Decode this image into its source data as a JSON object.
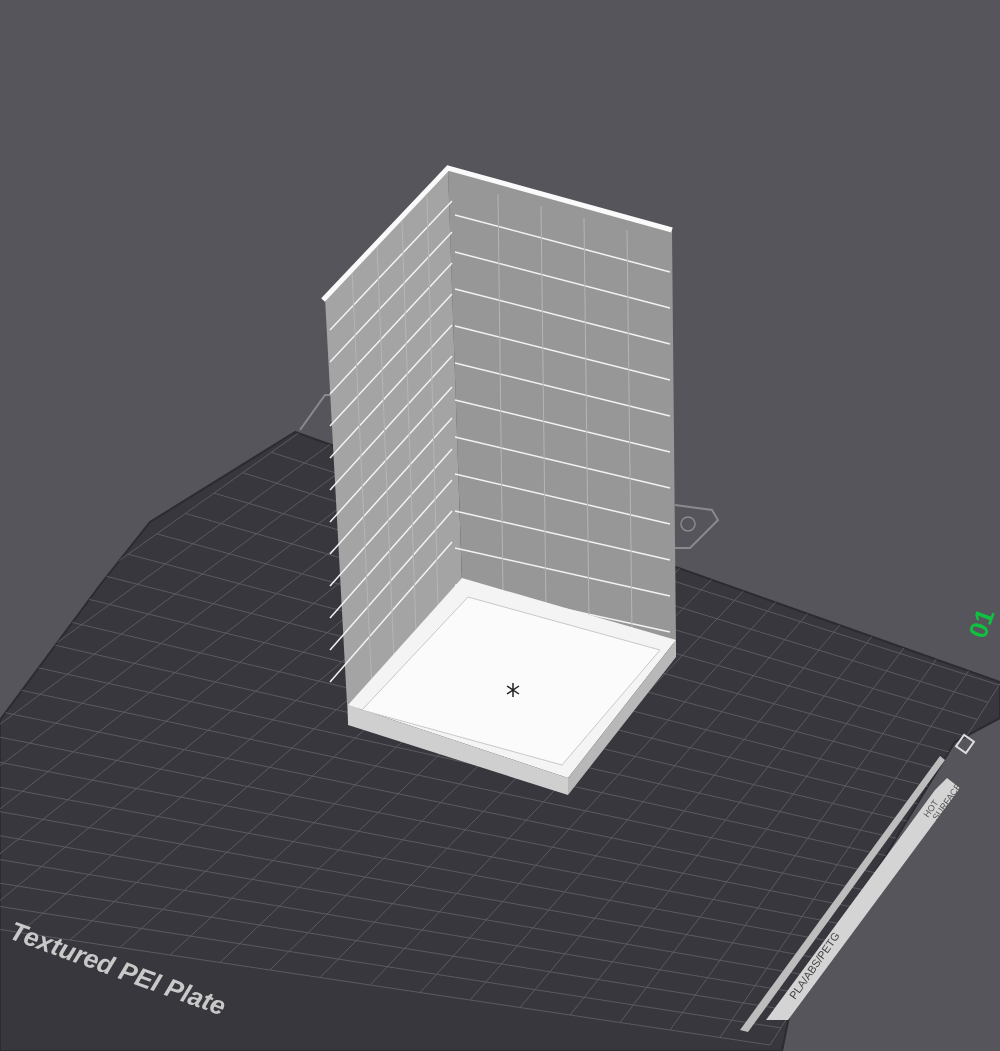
{
  "viewport": {
    "plate_label": "Textured PEI Plate",
    "plate_number": "01",
    "strip": {
      "materials": "PLA/ABS/PETG",
      "warning": [
        "HOT",
        "SURFACE"
      ]
    }
  }
}
